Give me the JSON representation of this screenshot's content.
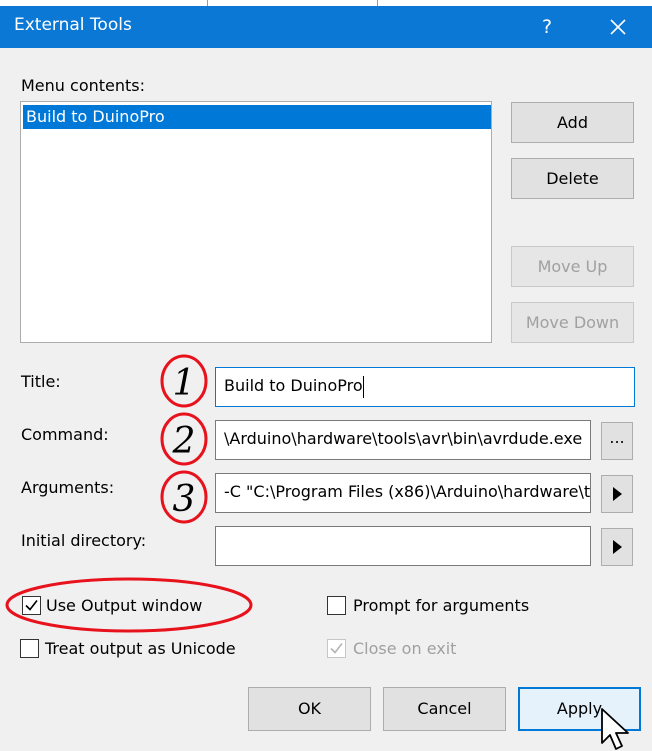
{
  "window": {
    "title": "External Tools",
    "help_label": "?"
  },
  "menu_contents": {
    "label": "Menu contents:",
    "items": [
      "Build to DuinoPro"
    ]
  },
  "side_buttons": {
    "add": "Add",
    "delete": "Delete",
    "move_up": "Move Up",
    "move_down": "Move Down"
  },
  "fields": {
    "title_label": "Title:",
    "title_value": "Build to DuinoPro",
    "command_label": "Command:",
    "command_value": "\\Arduino\\hardware\\tools\\avr\\bin\\avrdude.exe",
    "browse_label": "...",
    "arguments_label": "Arguments:",
    "arguments_value": "-C \"C:\\Program Files (x86)\\Arduino\\hardware\\t",
    "initial_directory_label": "Initial directory:",
    "initial_directory_value": ""
  },
  "options": {
    "use_output_window": {
      "label": "Use Output window",
      "checked": true
    },
    "prompt_for_arguments": {
      "label": "Prompt for arguments",
      "checked": false
    },
    "treat_output_as_unicode": {
      "label": "Treat output as Unicode",
      "checked": false
    },
    "close_on_exit": {
      "label": "Close on exit",
      "checked": true,
      "disabled": true
    }
  },
  "footer": {
    "ok": "OK",
    "cancel": "Cancel",
    "apply": "Apply"
  },
  "annotations": [
    "1",
    "2",
    "3"
  ],
  "colors": {
    "titlebar": "#0a78d4",
    "selection": "#0078d7",
    "annotation": "#e8121c",
    "dialog_background": "#f0f0f0"
  },
  "icons": {
    "close": "close-icon",
    "arrow": "play-arrow-icon",
    "check": "check-icon",
    "cursor": "mouse-pointer-icon"
  }
}
